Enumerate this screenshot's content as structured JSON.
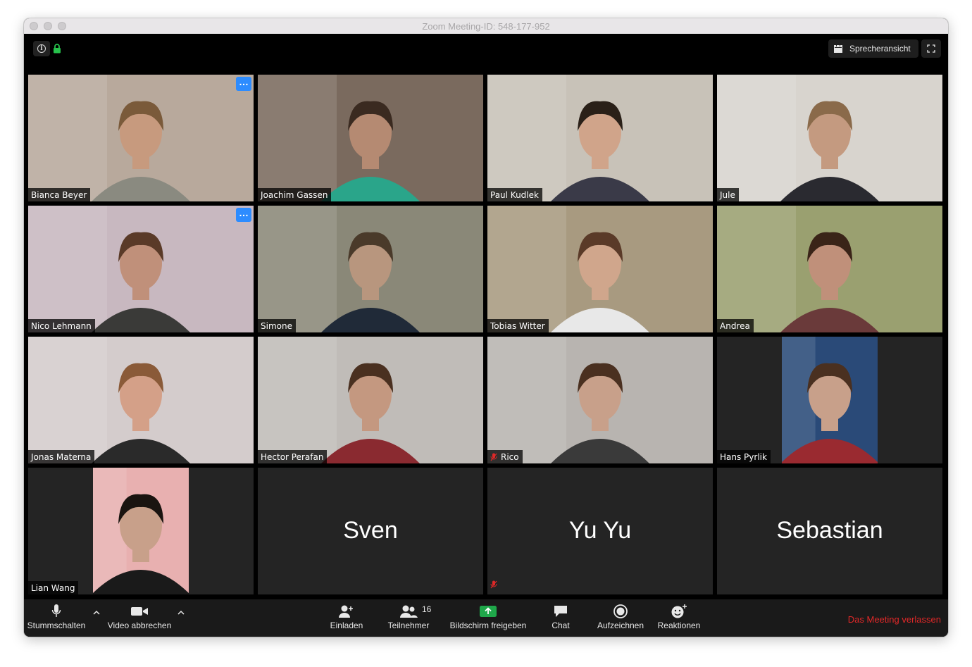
{
  "window": {
    "title": "Zoom Meeting-ID: 548-177-952"
  },
  "topbar": {
    "view_label": "Sprecheransicht"
  },
  "participants": [
    {
      "name": "Bianca Beyer",
      "type": "video",
      "bg": "#b8a99c",
      "face": "#c79a7e",
      "hair": "#7a5a3a",
      "shirt": "#8a8a80"
    },
    {
      "name": "Joachim Gassen",
      "type": "video",
      "bg": "#7a6a5e",
      "face": "#b58a72",
      "hair": "#3a2a20",
      "shirt": "#2aa58a"
    },
    {
      "name": "Paul Kudlek",
      "type": "video",
      "bg": "#c8c2b8",
      "face": "#d0a48a",
      "hair": "#2a2018",
      "shirt": "#3a3a48"
    },
    {
      "name": "Jule",
      "type": "video",
      "bg": "#d8d4ce",
      "face": "#c49a80",
      "hair": "#8a6a4a",
      "shirt": "#2a2a30"
    },
    {
      "name": "Nico Lehmann",
      "type": "video",
      "bg": "#c8b8c0",
      "face": "#c0907a",
      "hair": "#5a3a28",
      "shirt": "#3a3a38"
    },
    {
      "name": "Simone",
      "type": "video",
      "bg": "#8a8878",
      "face": "#b8967e",
      "hair": "#4a3a2a",
      "shirt": "#202a38"
    },
    {
      "name": "Tobias Witter",
      "type": "video",
      "bg": "#a89a80",
      "face": "#d0a68c",
      "hair": "#5a3a28",
      "shirt": "#e8e8e8"
    },
    {
      "name": "Andrea",
      "type": "video",
      "bg": "#9aa070",
      "face": "#c0907a",
      "hair": "#3a2418",
      "shirt": "#6a3a3a"
    },
    {
      "name": "Jonas Materna",
      "type": "video",
      "bg": "#d4cccc",
      "face": "#d4a088",
      "hair": "#8a5a38",
      "shirt": "#2a2a2a"
    },
    {
      "name": "Hector Perafan",
      "type": "video",
      "bg": "#c0bcb8",
      "face": "#c49880",
      "hair": "#4a3020",
      "shirt": "#8a2a30",
      "active": true
    },
    {
      "name": "Rico",
      "type": "video",
      "bg": "#b8b4b0",
      "face": "#c8a08a",
      "hair": "#4a3020",
      "shirt": "#3a3a3a",
      "muted": true
    },
    {
      "name": "Hans Pyrlik",
      "type": "video_narrow",
      "bg": "#2a4a78",
      "face": "#c8a08a",
      "hair": "#4a3020",
      "shirt": "#9a2a30"
    },
    {
      "name": "Lian Wang",
      "type": "video_narrow",
      "bg": "#e8b0b0",
      "face": "#c8a08a",
      "hair": "#1a1410",
      "shirt": "#1a1a1a"
    },
    {
      "name": "Sven",
      "type": "name"
    },
    {
      "name": "Yu Yu",
      "type": "name",
      "muted": true
    },
    {
      "name": "Sebastian",
      "type": "name"
    }
  ],
  "toolbar": {
    "mute_label": "Stummschalten",
    "video_label": "Video abbrechen",
    "invite_label": "Einladen",
    "participants_label": "Teilnehmer",
    "participants_count": "16",
    "share_label": "Bildschirm freigeben",
    "chat_label": "Chat",
    "record_label": "Aufzeichnen",
    "reactions_label": "Reaktionen",
    "leave_label": "Das Meeting verlassen"
  },
  "colors": {
    "accent": "#2d8cff",
    "share": "#1fa84a",
    "leave": "#e02828",
    "active_border": "#f0f0a8"
  }
}
